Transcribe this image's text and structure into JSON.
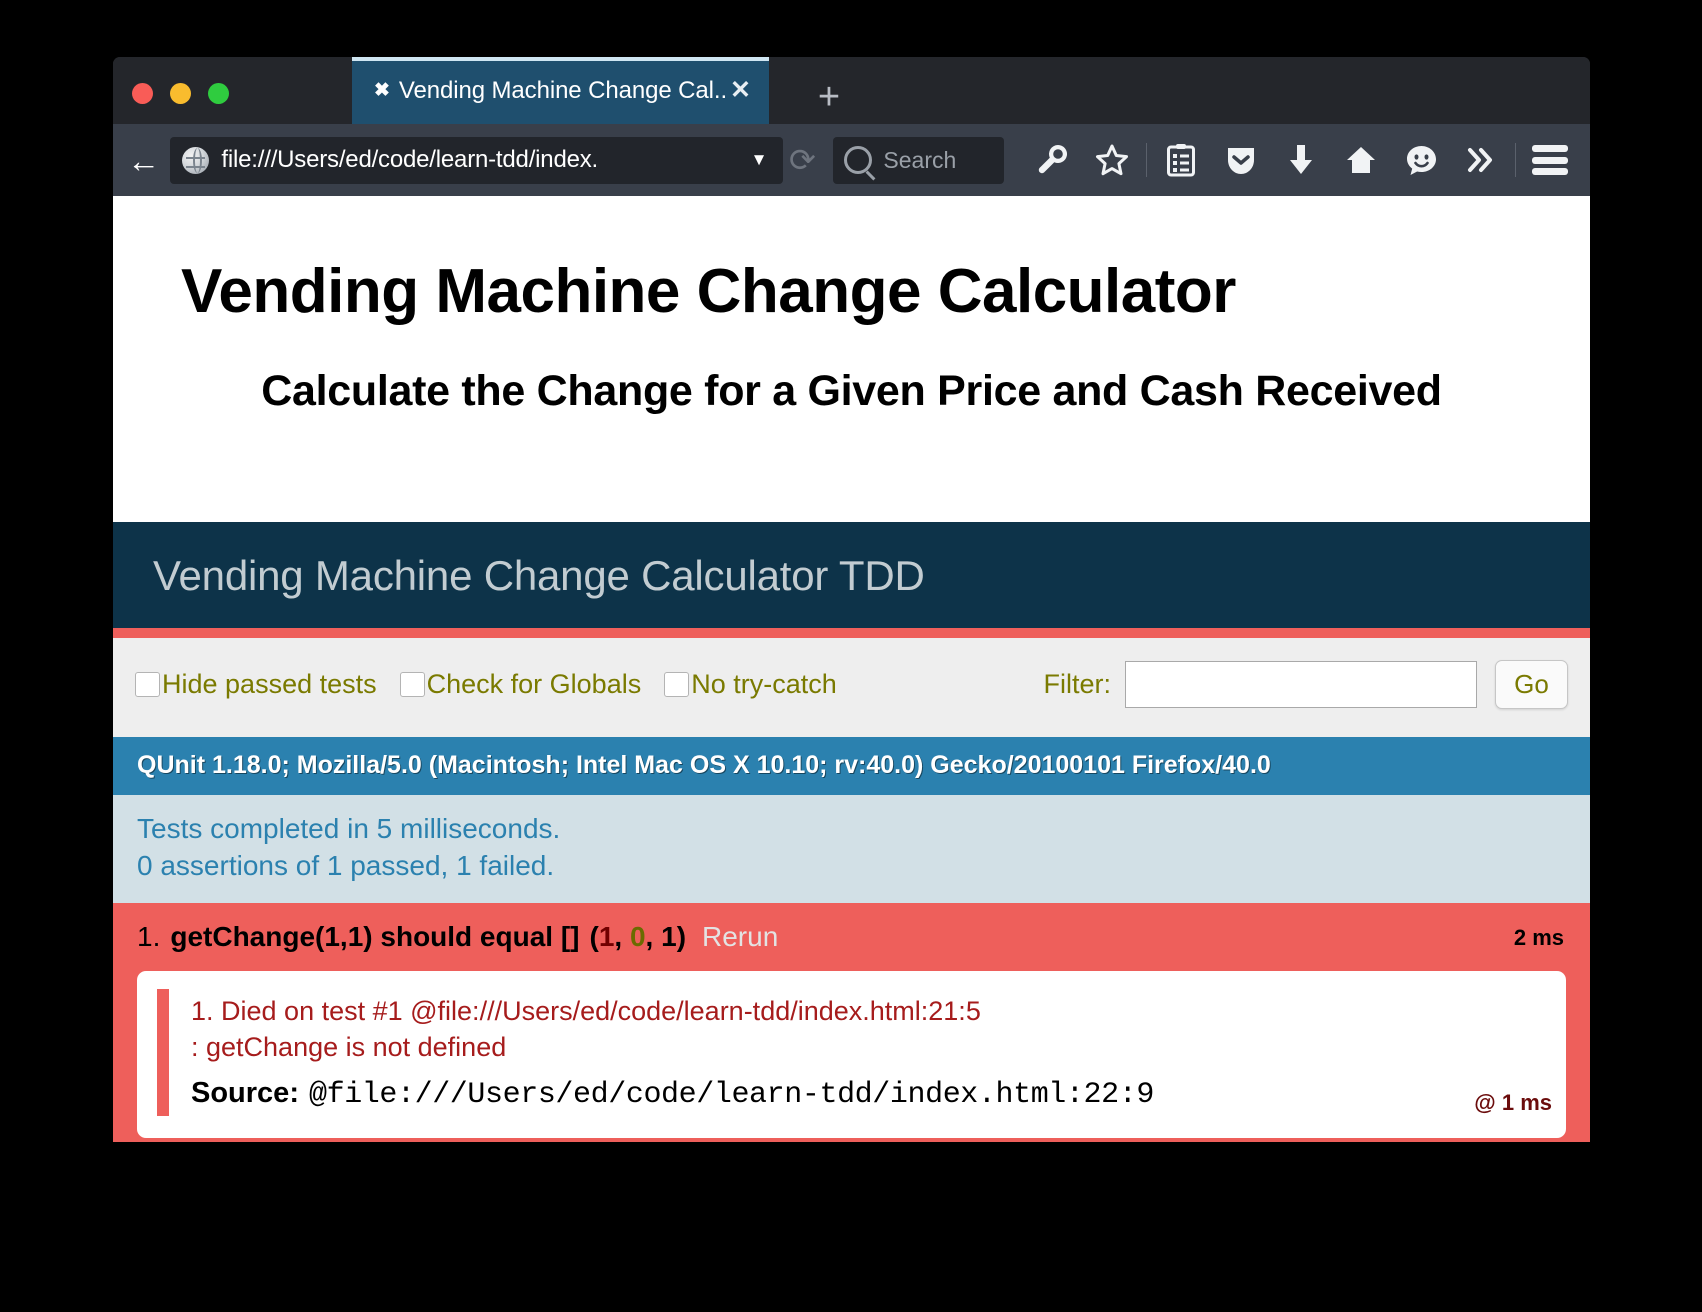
{
  "browser": {
    "traffic_lights": [
      "close",
      "minimize",
      "zoom"
    ],
    "tab": {
      "favicon": "✖",
      "title": "Vending Machine Change Cal...",
      "close": "✕"
    },
    "new_tab_label": "+",
    "back_label": "←",
    "url": "file:///Users/ed/code/learn-tdd/index.",
    "url_dropdown": "▼",
    "reload_label": "⟳",
    "search_placeholder": "Search",
    "toolbar_icons": [
      "wrench-icon",
      "star-icon",
      "reader-list-icon",
      "pocket-icon",
      "downloads-icon",
      "home-icon",
      "smiley-icon",
      "chevron-double-right-icon",
      "hamburger-menu-icon"
    ]
  },
  "page": {
    "title": "Vending Machine Change Calculator",
    "subtitle": "Calculate the Change for a Given Price and Cash Received"
  },
  "qunit": {
    "header": "Vending Machine Change Calculator TDD",
    "toolbar": {
      "checkboxes": [
        {
          "label": "Hide passed tests",
          "checked": false
        },
        {
          "label": "Check for Globals",
          "checked": false
        },
        {
          "label": "No try-catch",
          "checked": false
        }
      ],
      "filter_label": "Filter:",
      "filter_value": "",
      "filter_placeholder": "",
      "go_label": "Go"
    },
    "useragent": "QUnit 1.18.0; Mozilla/5.0 (Macintosh; Intel Mac OS X 10.10; rv:40.0) Gecko/20100101 Firefox/40.0",
    "testresult_line1": "Tests completed in 5 milliseconds.",
    "testresult_line2": "0 assertions of 1 passed, 1 failed.",
    "test": {
      "counter": "1.",
      "name": "getChange(1,1) should equal []",
      "counts_open": "(",
      "counts_failed": "1",
      "counts_sep1": ", ",
      "counts_passed": "0",
      "counts_sep2": ", ",
      "counts_total": "1",
      "counts_close": ")",
      "rerun_label": "Rerun",
      "runtime": "2 ms",
      "assertion": {
        "message_line1": "1. Died on test #1 @file:///Users/ed/code/learn-tdd/index.html:21:5",
        "message_line2": ": getChange is not defined",
        "source_label": "Source:",
        "source_value": "@file:///Users/ed/code/learn-tdd/index.html:22:9",
        "runtime": "@ 1 ms"
      }
    }
  },
  "colors": {
    "qunit_header_bg": "#0d3349",
    "qunit_accent": "#ee5f5b",
    "qunit_useragent_bg": "#2b81af",
    "qunit_result_bg": "#d2e0e6",
    "tab_active_bg": "#1f4f6e",
    "chrome_bg": "#393f4a"
  }
}
